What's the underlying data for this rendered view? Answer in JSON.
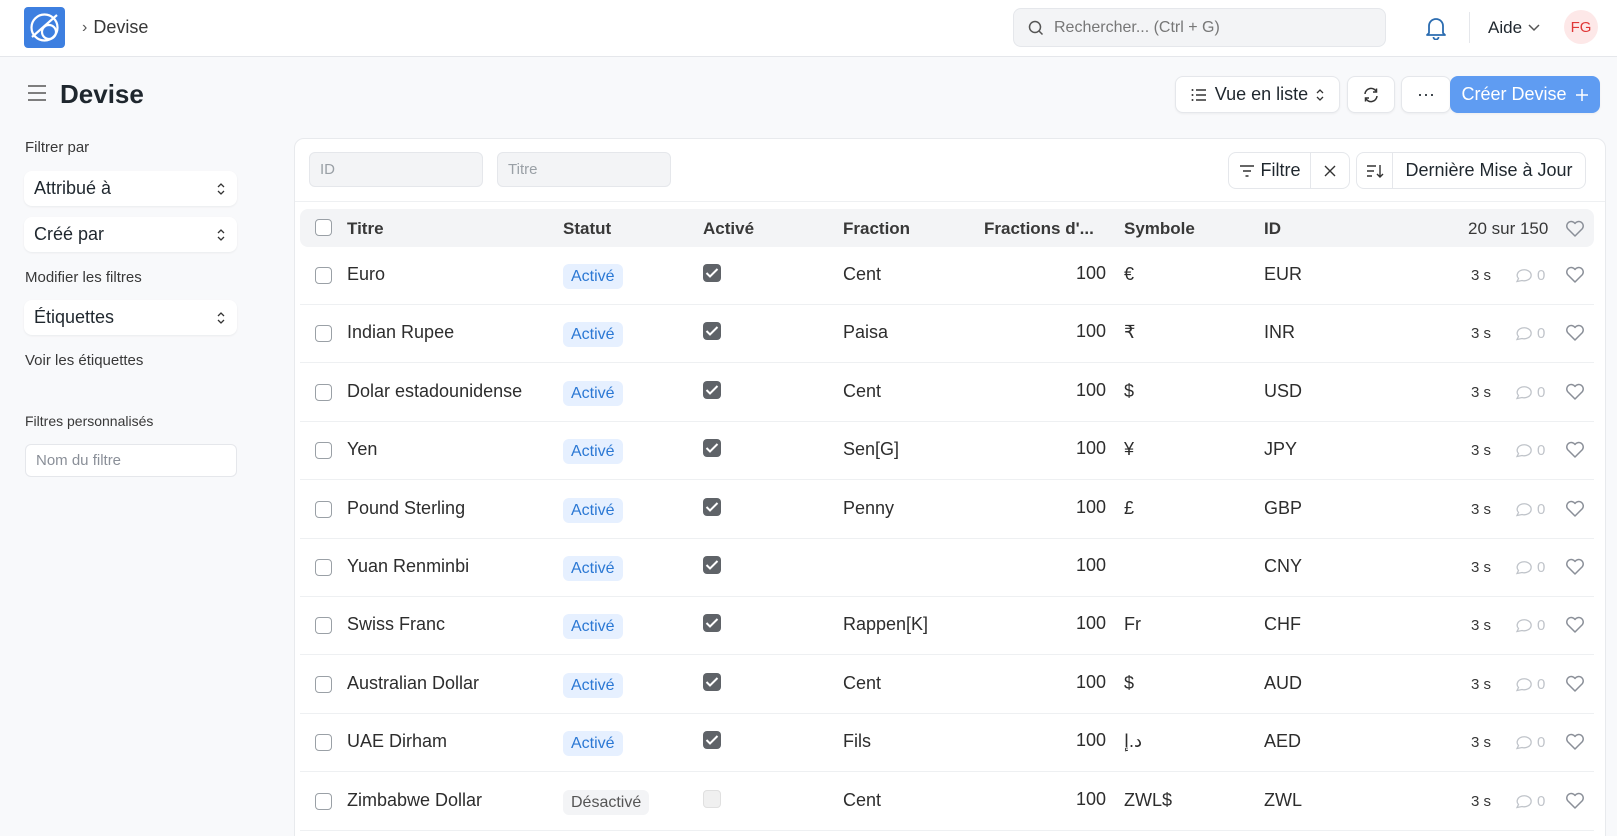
{
  "navbar": {
    "breadcrumb": "Devise",
    "search_placeholder": "Rechercher... (Ctrl + G)",
    "help_label": "Aide",
    "avatar_initials": "FG"
  },
  "page": {
    "title": "Devise",
    "view_label": "Vue en liste",
    "more_label": "···",
    "create_label": "Créer Devise"
  },
  "sidebar": {
    "filter_by": "Filtrer par",
    "assigned_to": "Attribué à",
    "created_by": "Créé par",
    "edit_filters": "Modifier les filtres",
    "tags": "Étiquettes",
    "show_tags": "Voir les étiquettes",
    "custom_filters": "Filtres personnalisés",
    "filter_name_placeholder": "Nom du filtre"
  },
  "filters": {
    "id_placeholder": "ID",
    "title_placeholder": "Titre",
    "filter_label": "Filtre",
    "sort_label": "Dernière Mise à Jour"
  },
  "table": {
    "headers": {
      "title": "Titre",
      "status": "Statut",
      "enabled": "Activé",
      "fraction": "Fraction",
      "fraction_units": "Fractions d'...",
      "symbol": "Symbole",
      "id": "ID",
      "count": "20 sur 150"
    },
    "rows": [
      {
        "title": "Euro",
        "status": "Activé",
        "enabled": true,
        "fraction": "Cent",
        "units": "100",
        "symbol": "€",
        "id": "EUR",
        "time": "3 s",
        "comments": "0"
      },
      {
        "title": "Indian Rupee",
        "status": "Activé",
        "enabled": true,
        "fraction": "Paisa",
        "units": "100",
        "symbol": "₹",
        "id": "INR",
        "time": "3 s",
        "comments": "0"
      },
      {
        "title": "Dolar estadounidense",
        "status": "Activé",
        "enabled": true,
        "fraction": "Cent",
        "units": "100",
        "symbol": "$",
        "id": "USD",
        "time": "3 s",
        "comments": "0"
      },
      {
        "title": "Yen",
        "status": "Activé",
        "enabled": true,
        "fraction": "Sen[G]",
        "units": "100",
        "symbol": "¥",
        "id": "JPY",
        "time": "3 s",
        "comments": "0"
      },
      {
        "title": "Pound Sterling",
        "status": "Activé",
        "enabled": true,
        "fraction": "Penny",
        "units": "100",
        "symbol": "£",
        "id": "GBP",
        "time": "3 s",
        "comments": "0"
      },
      {
        "title": "Yuan Renminbi",
        "status": "Activé",
        "enabled": true,
        "fraction": "",
        "units": "100",
        "symbol": "",
        "id": "CNY",
        "time": "3 s",
        "comments": "0"
      },
      {
        "title": "Swiss Franc",
        "status": "Activé",
        "enabled": true,
        "fraction": "Rappen[K]",
        "units": "100",
        "symbol": "Fr",
        "id": "CHF",
        "time": "3 s",
        "comments": "0"
      },
      {
        "title": "Australian Dollar",
        "status": "Activé",
        "enabled": true,
        "fraction": "Cent",
        "units": "100",
        "symbol": "$",
        "id": "AUD",
        "time": "3 s",
        "comments": "0"
      },
      {
        "title": "UAE Dirham",
        "status": "Activé",
        "enabled": true,
        "fraction": "Fils",
        "units": "100",
        "symbol": "د.إ",
        "id": "AED",
        "time": "3 s",
        "comments": "0"
      },
      {
        "title": "Zimbabwe Dollar",
        "status": "Désactivé",
        "enabled": false,
        "fraction": "Cent",
        "units": "100",
        "symbol": "ZWL$",
        "id": "ZWL",
        "time": "3 s",
        "comments": "0"
      }
    ]
  },
  "colors": {
    "accent": "#5f9cf2",
    "badge_active_bg": "#e6f0ff",
    "badge_active_text": "#2b78d4",
    "avatar_text": "#e03636"
  }
}
